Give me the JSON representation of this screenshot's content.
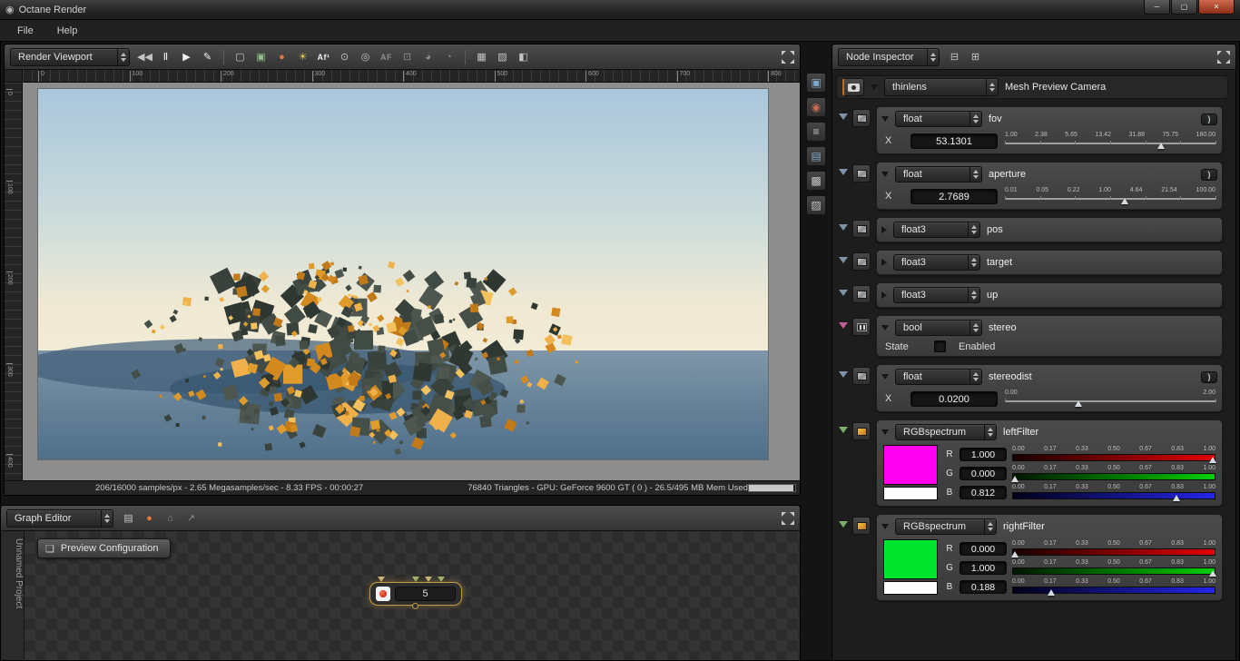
{
  "window": {
    "title": "Octane Render",
    "controls": [
      {
        "name": "minimize-button",
        "glyph": "─"
      },
      {
        "name": "maximize-button",
        "glyph": "▢"
      },
      {
        "name": "close-button",
        "glyph": "✕"
      }
    ]
  },
  "menu": {
    "file": "File",
    "help": "Help"
  },
  "viewport": {
    "selector": "Render Viewport",
    "toolbar": [
      {
        "name": "restart-render-icon",
        "glyph": "◀◀"
      },
      {
        "name": "pause-render-icon",
        "glyph": "Ⅱ",
        "cls": "bright"
      },
      {
        "name": "play-render-icon",
        "glyph": "▶",
        "cls": "bright"
      },
      {
        "name": "stop-render-icon",
        "glyph": "✎",
        "cls": "bright"
      },
      {
        "sep": true
      },
      {
        "name": "render-region-icon",
        "glyph": "▢"
      },
      {
        "name": "pick-camera-target-icon",
        "glyph": "▣",
        "cls": "green"
      },
      {
        "name": "pick-material-icon",
        "glyph": "●",
        "cls": "orange"
      },
      {
        "name": "pick-white-balance-icon",
        "glyph": "☀",
        "cls": "yellow"
      },
      {
        "name": "autofocus-one-icon",
        "glyph": "Af¹",
        "cls": "txt bright"
      },
      {
        "name": "pick-focus-icon",
        "glyph": "⊙"
      },
      {
        "name": "pick-focus-dot-icon",
        "glyph": "◎"
      },
      {
        "name": "autofocus-icon",
        "glyph": "AF",
        "cls": "txt dim"
      },
      {
        "name": "lock-resolution-icon",
        "glyph": "⊡",
        "cls": "dim"
      },
      {
        "name": "orbit-camera-icon",
        "glyph": "◕",
        "cls": "dim"
      },
      {
        "name": "pan-camera-icon",
        "glyph": "◔",
        "cls": "dim"
      },
      {
        "sep": true
      },
      {
        "name": "grid-overlay-icon",
        "glyph": "▦"
      },
      {
        "name": "alpha-checker-icon",
        "glyph": "▨"
      },
      {
        "name": "split-view-icon",
        "glyph": "◧"
      }
    ],
    "ruler_h": [
      "0",
      "100",
      "200",
      "300",
      "400",
      "500",
      "600",
      "700",
      "800"
    ],
    "ruler_v": [
      "0",
      "100",
      "200",
      "300",
      "400"
    ],
    "status_left": "206/16000 samples/px - 2.65 Megasamples/sec - 8.33 FPS - 00:00:27",
    "status_right": "76840 Triangles - GPU: GeForce 9600 GT ( 0 ) - 26.5/495 MB Mem Used"
  },
  "graph_editor": {
    "selector": "Graph Editor",
    "toolbar": [
      {
        "name": "save-image-icon",
        "glyph": "▤"
      },
      {
        "name": "material-ball-icon",
        "glyph": "●",
        "cls": "orange"
      },
      {
        "name": "mesh-node-icon",
        "glyph": "⌂",
        "cls": "dim"
      },
      {
        "name": "export-node-icon",
        "glyph": "↗",
        "cls": "dim"
      }
    ],
    "project_tab": "Unnamed Project",
    "preview_button": "Preview Configuration",
    "node_value": "5"
  },
  "side_strip": [
    {
      "name": "render-viewport-tab-icon",
      "glyph": "▣",
      "cls": "blue"
    },
    {
      "name": "camera-tab-icon",
      "glyph": "◉",
      "cls": "red"
    },
    {
      "name": "outliner-tab-icon",
      "glyph": "≡"
    },
    {
      "name": "library-tab-icon",
      "glyph": "▤",
      "cls": "blue"
    },
    {
      "name": "image-tab-icon",
      "glyph": "▩"
    },
    {
      "name": "environment-tab-icon",
      "glyph": "▨"
    }
  ],
  "node_inspector": {
    "selector": "Node Inspector",
    "header_icons": [
      {
        "name": "sync-selection-icon",
        "glyph": "⊟"
      },
      {
        "name": "float-window-icon",
        "glyph": "⊞"
      }
    ],
    "camera": {
      "type": "thinlens",
      "label": "Mesh Preview Camera"
    },
    "params": {
      "fov": {
        "type": "float",
        "label": "fov",
        "axis": "X",
        "value": "53.1301",
        "slider": {
          "ticks": [
            "1.00",
            "2.38",
            "5.65",
            "13.42",
            "31.88",
            "75.75",
            "180.00"
          ],
          "pos": 0.74
        }
      },
      "aperture": {
        "type": "float",
        "label": "aperture",
        "axis": "X",
        "value": "2.7689",
        "slider": {
          "ticks": [
            "0.01",
            "0.05",
            "0.22",
            "1.00",
            "4.64",
            "21.54",
            "100.00"
          ],
          "pos": 0.57
        }
      },
      "pos": {
        "type": "float3",
        "label": "pos"
      },
      "target": {
        "type": "float3",
        "label": "target"
      },
      "up": {
        "type": "float3",
        "label": "up"
      },
      "stereo": {
        "type": "bool",
        "label": "stereo",
        "state_label": "State",
        "check_label": "Enabled"
      },
      "stereodist": {
        "type": "float",
        "label": "stereodist",
        "axis": "X",
        "value": "0.0200",
        "slider": {
          "ticks": [
            "0.00",
            "2.00"
          ],
          "pos": 0.35
        }
      },
      "leftFilter": {
        "type": "RGBspectrum",
        "label": "leftFilter",
        "swatch": "#ff00f0",
        "channels": [
          {
            "ch": "R",
            "value": "1.000",
            "slider": {
              "ticks": [
                "0.00",
                "0.17",
                "0.33",
                "0.50",
                "0.67",
                "0.83",
                "1.00"
              ],
              "pos": 0.985,
              "grad": "red"
            }
          },
          {
            "ch": "G",
            "value": "0.000",
            "slider": {
              "ticks": [
                "0.00",
                "0.17",
                "0.33",
                "0.50",
                "0.67",
                "0.83",
                "1.00"
              ],
              "pos": 0.012,
              "grad": "green"
            }
          },
          {
            "ch": "B",
            "value": "0.812",
            "slider": {
              "ticks": [
                "0.00",
                "0.17",
                "0.33",
                "0.50",
                "0.67",
                "0.83",
                "1.00"
              ],
              "pos": 0.81,
              "grad": "blue"
            }
          }
        ]
      },
      "rightFilter": {
        "type": "RGBspectrum",
        "label": "rightFilter",
        "swatch": "#00e52e",
        "channels": [
          {
            "ch": "R",
            "value": "0.000",
            "slider": {
              "ticks": [
                "0.00",
                "0.17",
                "0.33",
                "0.50",
                "0.67",
                "0.83",
                "1.00"
              ],
              "pos": 0.012,
              "grad": "red"
            }
          },
          {
            "ch": "G",
            "value": "1.000",
            "slider": {
              "ticks": [
                "0.00",
                "0.17",
                "0.33",
                "0.50",
                "0.67",
                "0.83",
                "1.00"
              ],
              "pos": 0.985,
              "grad": "green"
            }
          },
          {
            "ch": "B",
            "value": "0.188",
            "slider": {
              "ticks": [
                "0.00",
                "0.17",
                "0.33",
                "0.50",
                "0.67",
                "0.83",
                "1.00"
              ],
              "pos": 0.19,
              "grad": "blue"
            }
          }
        ]
      }
    }
  }
}
